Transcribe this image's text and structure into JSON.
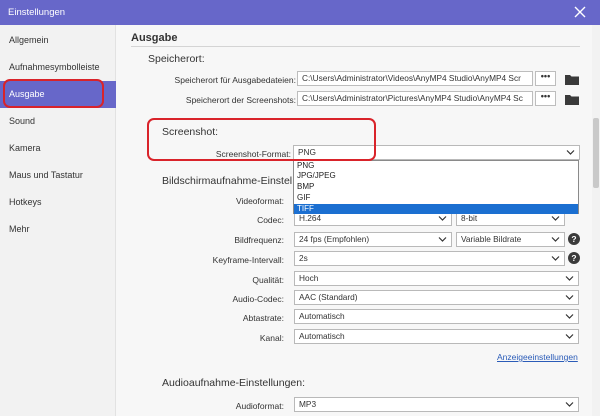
{
  "window": {
    "title": "Einstellungen"
  },
  "sidebar": {
    "items": [
      {
        "label": "Allgemein"
      },
      {
        "label": "Aufnahmesymbolleiste"
      },
      {
        "label": "Ausgabe"
      },
      {
        "label": "Sound"
      },
      {
        "label": "Kamera"
      },
      {
        "label": "Maus und Tastatur"
      },
      {
        "label": "Hotkeys"
      },
      {
        "label": "Mehr"
      }
    ],
    "active_index": 2
  },
  "main": {
    "section_title": "Ausgabe",
    "speicherort": {
      "title": "Speicherort:",
      "output_label": "Speicherort für Ausgabedateien:",
      "output_path": "C:\\Users\\Administrator\\Videos\\AnyMP4 Studio\\AnyMP4 Scr",
      "screenshot_label": "Speicherort der Screenshots:",
      "screenshot_path": "C:\\Users\\Administrator\\Pictures\\AnyMP4 Studio\\AnyMP4 Sc",
      "browse_label": "•••"
    },
    "screenshot": {
      "title": "Screenshot:",
      "format_label": "Screenshot-Format:",
      "format_value": "PNG",
      "options": [
        "PNG",
        "JPG/JPEG",
        "BMP",
        "GIF",
        "TIFF"
      ],
      "highlighted_option": "TIFF"
    },
    "video": {
      "title": "Bildschirmaufnahme-Einstel",
      "videoformat_label": "Videoformat:",
      "codec_label": "Codec:",
      "codec_value": "H.264",
      "bitdepth_value": "8-bit",
      "framerate_label": "Bildfrequenz:",
      "framerate_value": "24 fps (Empfohlen)",
      "bitrate_mode_value": "Variable Bildrate",
      "keyframe_label": "Keyframe-Intervall:",
      "keyframe_value": "2s",
      "quality_label": "Qualität:",
      "quality_value": "Hoch",
      "audio_codec_label": "Audio-Codec:",
      "audio_codec_value": "AAC (Standard)",
      "samplerate_label": "Abtastrate:",
      "samplerate_value": "Automatisch",
      "channels_label": "Kanal:",
      "channels_value": "Automatisch",
      "display_settings_link": "Anzeigeeinstellungen",
      "help_label": "?"
    },
    "audio": {
      "title": "Audioaufnahme-Einstellungen:",
      "format_label": "Audioformat:",
      "format_value": "MP3"
    }
  },
  "colors": {
    "accent": "#6767c9",
    "highlight_outline": "#d9232a",
    "dropdown_selection": "#1b6fd1",
    "link": "#2b5cb8"
  },
  "icons": {
    "close": "close-icon",
    "browse": "more-dots-icon",
    "folder": "folder-icon",
    "dropdown": "chevron-down-icon",
    "help": "help-icon"
  }
}
